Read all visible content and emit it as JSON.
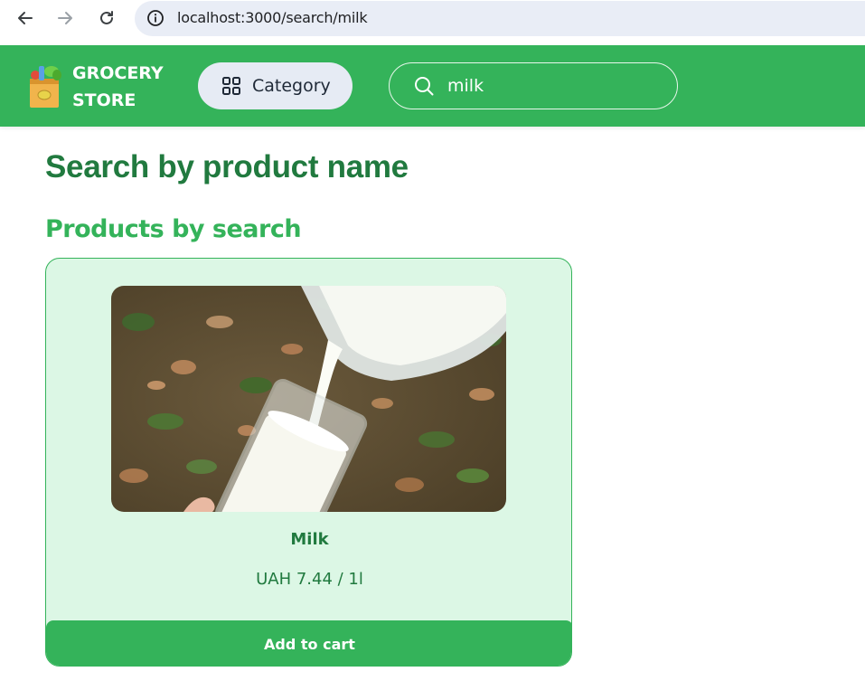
{
  "browser": {
    "url": "localhost:3000/search/milk",
    "back_icon": "arrow-left-icon",
    "forward_icon": "arrow-right-icon",
    "reload_icon": "reload-icon",
    "info_icon": "info-icon"
  },
  "header": {
    "logo_line1": "GROCERY",
    "logo_line2": "STORE",
    "logo_icon": "grocery-bag-icon",
    "category_label": "Category",
    "category_icon": "grid-icon",
    "search_icon": "search-icon",
    "search_value": "milk",
    "colors": {
      "brand": "#34b35a",
      "category_bg": "#e6ebf4"
    }
  },
  "main": {
    "page_title": "Search by product name",
    "section_title": "Products by search",
    "products": [
      {
        "name": "Milk",
        "price": "UAH 7.44 / 1l",
        "button_label": "Add to cart",
        "image": "milk-pouring-image"
      }
    ]
  }
}
